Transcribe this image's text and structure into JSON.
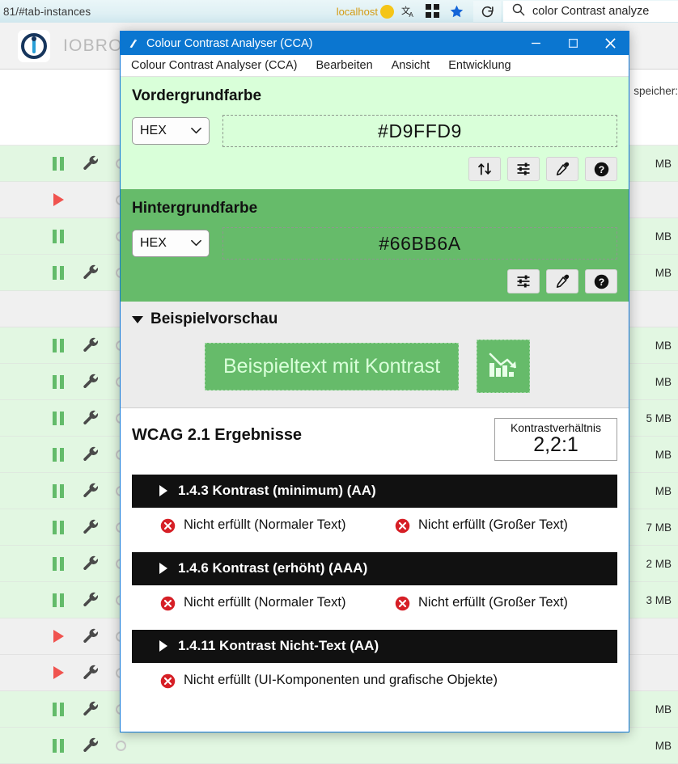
{
  "browser": {
    "url_fragment": "81/#tab-instances",
    "localhost_label": "localhost",
    "search_query": "color Contrast analyze",
    "icons": {
      "yellow_badge": "yellow-dot-icon",
      "translate": "translate-icon",
      "grid": "grid-expand-icon",
      "favorite": "star-icon",
      "reload": "reload-icon",
      "search": "search-icon"
    }
  },
  "iobroker": {
    "brand": "IOBROKER",
    "memory_label": "speicher: ",
    "rows": [
      {
        "state": "white",
        "ctrl": "",
        "wrench": false,
        "mem": ""
      },
      {
        "state": "green",
        "ctrl": "pause",
        "wrench": true,
        "mem": "MB"
      },
      {
        "state": "gray",
        "ctrl": "play",
        "wrench": false,
        "mem": ""
      },
      {
        "state": "green",
        "ctrl": "pause",
        "wrench": false,
        "mem": "MB"
      },
      {
        "state": "green",
        "ctrl": "pause",
        "wrench": true,
        "mem": "MB"
      },
      {
        "state": "gray",
        "ctrl": "",
        "wrench": false,
        "mem": ""
      },
      {
        "state": "green",
        "ctrl": "pause",
        "wrench": true,
        "mem": "MB"
      },
      {
        "state": "green",
        "ctrl": "pause",
        "wrench": true,
        "mem": "MB"
      },
      {
        "state": "green",
        "ctrl": "pause",
        "wrench": true,
        "mem": "5 MB"
      },
      {
        "state": "green",
        "ctrl": "pause",
        "wrench": true,
        "mem": "MB"
      },
      {
        "state": "green",
        "ctrl": "pause",
        "wrench": true,
        "mem": "MB"
      },
      {
        "state": "green",
        "ctrl": "pause",
        "wrench": true,
        "mem": "7 MB"
      },
      {
        "state": "green",
        "ctrl": "pause",
        "wrench": true,
        "mem": "2 MB"
      },
      {
        "state": "green",
        "ctrl": "pause",
        "wrench": true,
        "mem": "3 MB"
      },
      {
        "state": "gray",
        "ctrl": "play",
        "wrench": true,
        "mem": ""
      },
      {
        "state": "gray",
        "ctrl": "play",
        "wrench": true,
        "mem": ""
      },
      {
        "state": "green",
        "ctrl": "pause",
        "wrench": true,
        "mem": "MB"
      },
      {
        "state": "green",
        "ctrl": "pause",
        "wrench": true,
        "mem": "MB"
      }
    ]
  },
  "cca": {
    "window_title": "Colour Contrast Analyser (CCA)",
    "titlebar_buttons": {
      "minimize": "—",
      "maximize": "☐",
      "close": "×"
    },
    "menu": [
      "Colour Contrast Analyser (CCA)",
      "Bearbeiten",
      "Ansicht",
      "Entwicklung"
    ],
    "foreground": {
      "heading": "Vordergrundfarbe",
      "format": "HEX",
      "value": "#D9FFD9",
      "swatch": "#D9FFD9",
      "buttons": [
        "swap-icon",
        "sliders-icon",
        "eyedropper-icon",
        "help-icon"
      ]
    },
    "background": {
      "heading": "Hintergrundfarbe",
      "format": "HEX",
      "value": "#66BB6A",
      "swatch": "#66BB6A",
      "buttons": [
        "sliders-icon",
        "eyedropper-icon",
        "help-icon"
      ]
    },
    "preview": {
      "heading": "Beispielvorschau",
      "sample_text": "Beispieltext mit Kontrast",
      "sample_icon": "declining-bar-chart-icon"
    },
    "results": {
      "heading": "WCAG 2.1 Ergebnisse",
      "ratio_caption": "Kontrastverhältnis",
      "ratio_value": "2,2:1",
      "criteria": [
        {
          "label": "1.4.3 Kontrast (minimum) (AA)",
          "results": [
            "Nicht erfüllt (Normaler Text)",
            "Nicht erfüllt (Großer Text)"
          ]
        },
        {
          "label": "1.4.6 Kontrast (erhöht) (AAA)",
          "results": [
            "Nicht erfüllt (Normaler Text)",
            "Nicht erfüllt (Großer Text)"
          ]
        },
        {
          "label": "1.4.11 Kontrast Nicht-Text (AA)",
          "results": [
            "Nicht erfüllt (UI-Komponenten und grafische Objekte)"
          ]
        }
      ]
    },
    "colors": {
      "titlebar": "#0b76d0",
      "foreground_panel": "#d9ffd9",
      "background_panel": "#66bb6a",
      "criterion_bar": "#111111",
      "fail_icon": "#d61f26"
    }
  }
}
